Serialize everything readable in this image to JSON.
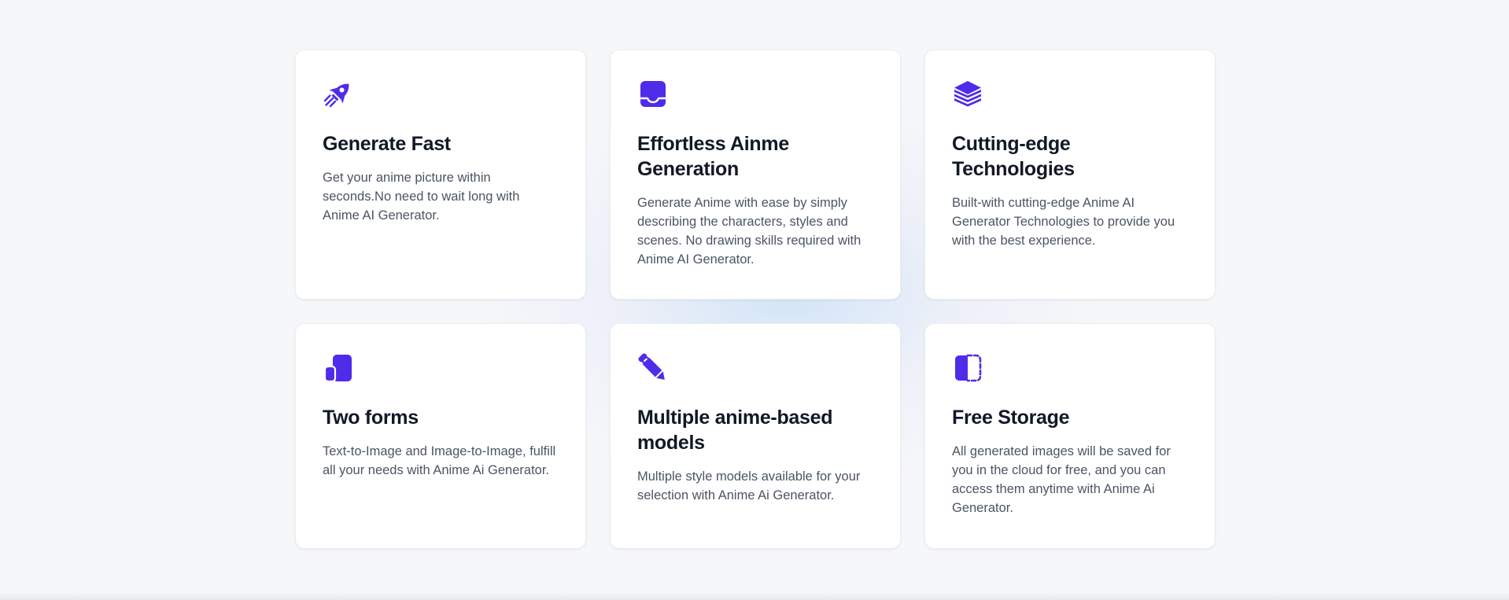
{
  "features": [
    {
      "icon": "rocket-icon",
      "title": "Generate Fast",
      "description": "Get your anime picture within seconds.No need to wait long with Anime AI Generator."
    },
    {
      "icon": "laptop-icon",
      "title": "Effortless Ainme Generation",
      "description": "Generate Anime with ease by simply describing the characters, styles and scenes. No drawing skills required with Anime AI Generator."
    },
    {
      "icon": "layers-icon",
      "title": "Cutting-edge Technologies",
      "description": "Built-with cutting-edge Anime AI Generator Technologies to provide you with the best experience."
    },
    {
      "icon": "two-squares-icon",
      "title": "Two forms",
      "description": "Text-to-Image and Image-to-Image, fulfill all your needs with Anime Ai Generator."
    },
    {
      "icon": "pencil-icon",
      "title": "Multiple anime-based models",
      "description": "Multiple style models available for your selection with Anime Ai Generator."
    },
    {
      "icon": "half-square-icon",
      "title": "Free Storage",
      "description": "All generated images will be saved for you in the cloud for free, and you can access them anytime with Anime Ai Generator."
    }
  ],
  "colors": {
    "accent": "#4f2bea",
    "title": "#111827",
    "text": "#4b5563",
    "card": "#ffffff",
    "background": "#f6f7f9"
  }
}
